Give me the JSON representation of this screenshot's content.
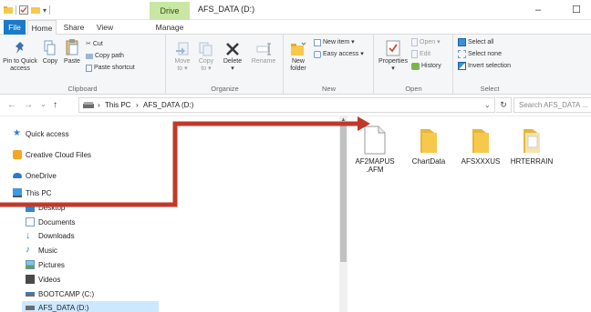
{
  "window": {
    "title": "AFS_DATA (D:)",
    "context_tab": "Drive Tools",
    "minimize_glyph": "–",
    "maximize_glyph": "☐"
  },
  "tabs": [
    {
      "label": "File"
    },
    {
      "label": "Home"
    },
    {
      "label": "Share"
    },
    {
      "label": "View"
    },
    {
      "label": "Manage"
    }
  ],
  "ribbon": {
    "clipboard": {
      "label": "Clipboard",
      "pin_line1": "Pin to Quick",
      "pin_line2": "access",
      "copy": "Copy",
      "paste": "Paste",
      "cut": "Cut",
      "copy_path": "Copy path",
      "paste_shortcut": "Paste shortcut"
    },
    "organize": {
      "label": "Organize",
      "move_to": "Move",
      "move_to2": "to ▾",
      "copy_to": "Copy",
      "copy_to2": "to ▾",
      "delete": "Delete",
      "delete2": "▾",
      "rename": "Rename"
    },
    "new": {
      "label": "New",
      "new_folder": "New",
      "new_folder2": "folder",
      "new_item": "New item ▾",
      "easy_access": "Easy access ▾"
    },
    "open": {
      "label": "Open",
      "properties": "Properties",
      "properties2": "▾",
      "open": "Open ▾",
      "edit": "Edit",
      "history": "History"
    },
    "select": {
      "label": "Select",
      "select_all": "Select all",
      "select_none": "Select none",
      "invert": "Invert selection"
    }
  },
  "address": {
    "back": "←",
    "forward": "→",
    "recent": "⌄",
    "up": "↑",
    "crumbs": [
      "This PC",
      "AFS_DATA (D:)"
    ],
    "separator": "›",
    "dropdown": "⌄",
    "refresh": "↻",
    "search_placeholder": "Search AFS_DATA ..."
  },
  "nav_pane": {
    "items": [
      {
        "label": "Quick access",
        "icon": "star-icon"
      },
      {
        "label": "Creative Cloud Files",
        "icon": "creative-cloud-icon"
      },
      {
        "label": "OneDrive",
        "icon": "onedrive-icon"
      },
      {
        "label": "This PC",
        "icon": "computer-icon"
      },
      {
        "label": "Desktop",
        "icon": "desktop-icon"
      },
      {
        "label": "Documents",
        "icon": "documents-icon"
      },
      {
        "label": "Downloads",
        "icon": "downloads-icon"
      },
      {
        "label": "Music",
        "icon": "music-icon"
      },
      {
        "label": "Pictures",
        "icon": "pictures-icon"
      },
      {
        "label": "Videos",
        "icon": "videos-icon"
      },
      {
        "label": "BOOTCAMP (C:)",
        "icon": "drive-icon"
      },
      {
        "label": "AFS_DATA (D:)",
        "icon": "drive-icon"
      }
    ]
  },
  "files": [
    {
      "name": "AF2MAPUS .AFM",
      "type": "file"
    },
    {
      "name": "ChartData",
      "type": "folder"
    },
    {
      "name": "AFSXXXUS",
      "type": "folder"
    },
    {
      "name": "HRTERRAIN",
      "type": "folder"
    }
  ],
  "colors": {
    "accent": "#1979ca",
    "context_tab": "#c9e7a4",
    "arrow": "#c0392b",
    "selection": "#cce8ff",
    "folder": "#f6c94c"
  }
}
